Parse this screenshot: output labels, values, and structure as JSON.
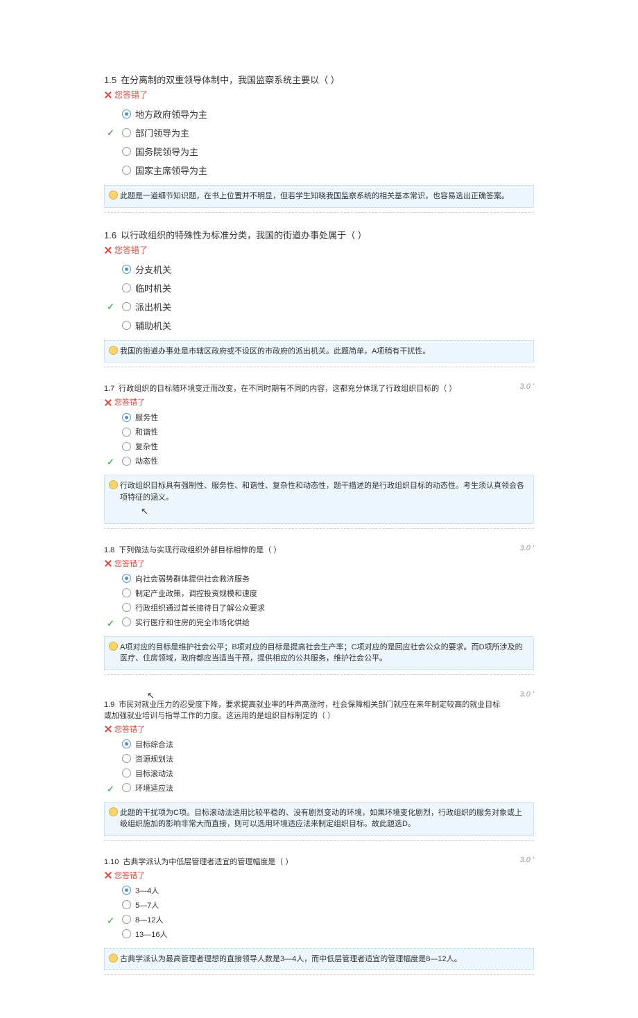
{
  "feedback_label": "您答错了",
  "items": [
    {
      "num": "1.5",
      "text": "在分离制的双重领导体制中，我国监察系统主要以（  ）",
      "score": "",
      "compact": false,
      "cursor": "",
      "options": [
        {
          "text": "地方政府领导为主",
          "selected": true,
          "correct": false
        },
        {
          "text": "部门领导为主",
          "selected": false,
          "correct": true
        },
        {
          "text": "国务院领导为主",
          "selected": false,
          "correct": false
        },
        {
          "text": "国家主席领导为主",
          "selected": false,
          "correct": false
        }
      ],
      "explanation": "此题是一道细节知识题，在书上位置并不明显，但若学生知晓我国监察系统的相关基本常识，也容易选出正确答案。"
    },
    {
      "num": "1.6",
      "text": "以行政组织的特殊性为标准分类，我国的街道办事处属于（  ）",
      "score": "",
      "compact": false,
      "cursor": "",
      "options": [
        {
          "text": "分支机关",
          "selected": true,
          "correct": false
        },
        {
          "text": "临时机关",
          "selected": false,
          "correct": false
        },
        {
          "text": "派出机关",
          "selected": false,
          "correct": true
        },
        {
          "text": "辅助机关",
          "selected": false,
          "correct": false
        }
      ],
      "explanation": "我国的街道办事处是市辖区政府或不设区的市政府的派出机关。此题简单，A项稍有干扰性。"
    },
    {
      "num": "1.7",
      "text": "行政组织的目标随环境变迁而改变，在不同时期有不同的内容，这都充分体现了行政组织目标的（ ）",
      "score": "3.0 '",
      "compact": true,
      "cursor": "after",
      "options": [
        {
          "text": "服务性",
          "selected": true,
          "correct": false
        },
        {
          "text": "和谐性",
          "selected": false,
          "correct": false
        },
        {
          "text": "复杂性",
          "selected": false,
          "correct": false
        },
        {
          "text": "动态性",
          "selected": false,
          "correct": true
        }
      ],
      "explanation": "行政组织目标具有强制性、服务性、和谐性、复杂性和动态性，题干描述的是行政组织目标的动态性。考生须认真领会各项特征的涵义。"
    },
    {
      "num": "1.8",
      "text": "下列做法与实现行政组织外部目标相悖的是（ ）",
      "score": "3.0 '",
      "compact": true,
      "cursor": "",
      "options": [
        {
          "text": "向社会弱势群体提供社会救济服务",
          "selected": true,
          "correct": false
        },
        {
          "text": "制定产业政策，调控投资规模和速度",
          "selected": false,
          "correct": false
        },
        {
          "text": "行政组织通过首长接待日了解公众要求",
          "selected": false,
          "correct": false
        },
        {
          "text": "实行医疗和住房的完全市场化供给",
          "selected": false,
          "correct": true
        }
      ],
      "explanation": "A项对应的目标是维护社会公平；B项对应的目标是提高社会生产率；C项对应的是回应社会公众的要求。而D项所涉及的医疗、住房领域，政府都应当适当干预，提供相应的公共服务，维护社会公平。"
    },
    {
      "num": "1.9",
      "text": "市民对就业压力的忍受度下降，要求提高就业率的呼声高涨时，社会保障相关部门就应在来年制定较高的就业目标或加强就业培训与指导工作的力度。这运用的是组织目标制定的（ ）",
      "score": "3.0 '",
      "compact": true,
      "cursor": "before",
      "options": [
        {
          "text": "目标综合法",
          "selected": true,
          "correct": false
        },
        {
          "text": "资源规划法",
          "selected": false,
          "correct": false
        },
        {
          "text": "目标滚动法",
          "selected": false,
          "correct": false
        },
        {
          "text": "环境适应法",
          "selected": false,
          "correct": true
        }
      ],
      "explanation": "此题的干扰项为C项。目标滚动法适用比较平稳的、没有剧烈变动的环境，如果环境变化剧烈，行政组织的服务对象或上级组织施加的影响非常大而直接，则可以选用环境适应法来制定组织目标。故此题选D。"
    },
    {
      "num": "1.10",
      "text": "古典学派认为中低层管理者适宜的管理幅度是（ ）",
      "score": "3.0 '",
      "compact": true,
      "cursor": "",
      "options": [
        {
          "text": "3—4人",
          "selected": true,
          "correct": false
        },
        {
          "text": "5—7人",
          "selected": false,
          "correct": false
        },
        {
          "text": "8—12人",
          "selected": false,
          "correct": true
        },
        {
          "text": "13—16人",
          "selected": false,
          "correct": false
        }
      ],
      "explanation": "古典学派认为最高管理者理想的直接领导人数是3—4人，而中低层管理者适宜的管理幅度是8—12人。"
    }
  ]
}
